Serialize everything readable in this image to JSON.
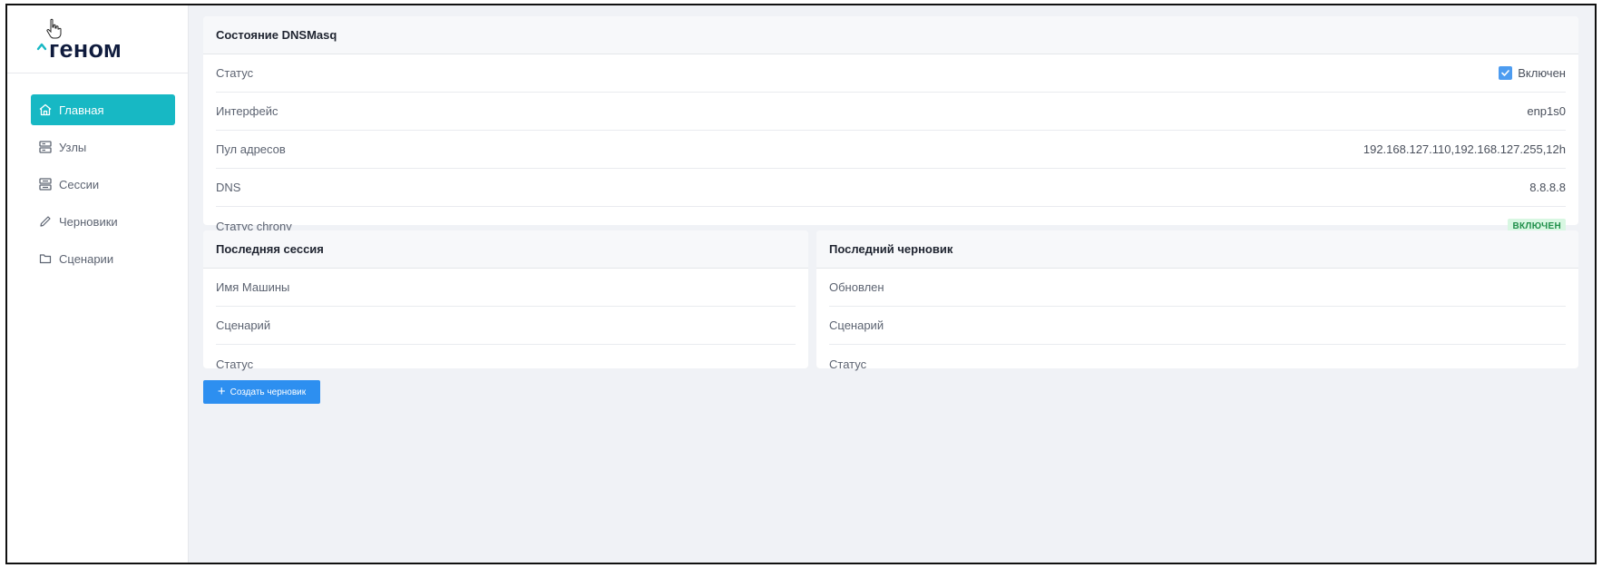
{
  "app": {
    "logo_text": "геном"
  },
  "sidebar": {
    "items": [
      {
        "label": "Главная",
        "icon": "home-icon",
        "active": true
      },
      {
        "label": "Узлы",
        "icon": "server-icon",
        "active": false
      },
      {
        "label": "Сессии",
        "icon": "server-stack-icon",
        "active": false
      },
      {
        "label": "Черновики",
        "icon": "pencil-icon",
        "active": false
      },
      {
        "label": "Сценарии",
        "icon": "folder-icon",
        "active": false
      }
    ]
  },
  "dnsmasq": {
    "title": "Состояние DNSMasq",
    "rows": [
      {
        "label": "Статус",
        "value": "Включен",
        "type": "checkbox",
        "checked": true
      },
      {
        "label": "Интерфейс",
        "value": "enp1s0"
      },
      {
        "label": "Пул адресов",
        "value": "192.168.127.110,192.168.127.255,12h"
      },
      {
        "label": "DNS",
        "value": "8.8.8.8"
      },
      {
        "label": "Статус chrony",
        "value": "ВКЛЮЧЕН",
        "type": "badge"
      }
    ]
  },
  "last_session": {
    "title": "Последняя сессия",
    "rows": [
      {
        "label": "Имя Машины"
      },
      {
        "label": "Сценарий"
      },
      {
        "label": "Статус"
      }
    ]
  },
  "last_draft": {
    "title": "Последний черновик",
    "rows": [
      {
        "label": "Обновлен"
      },
      {
        "label": "Сценарий"
      },
      {
        "label": "Статус"
      }
    ]
  },
  "actions": {
    "create_draft_label": "Создать черновик"
  },
  "colors": {
    "accent": "#17b8c4",
    "primary_button": "#2d8ff0",
    "checkbox": "#4d9cf0",
    "badge_bg": "#d8f7e2",
    "badge_text": "#1f8f4a"
  }
}
